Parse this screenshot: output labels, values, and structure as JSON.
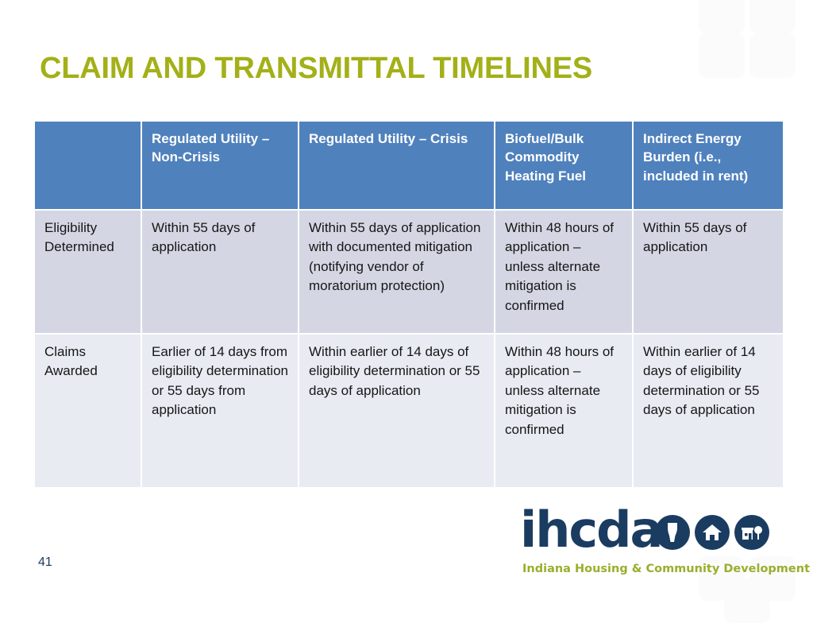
{
  "slide": {
    "title": "CLAIM AND TRANSMITTAL TIMELINES",
    "page_number": "41",
    "title_color": "#A3B018",
    "header_color": "#4F81BD",
    "row1_color": "#D4D7E3",
    "row2_color": "#E8EBF2"
  },
  "table": {
    "headers": [
      "",
      "Regulated Utility – Non-Crisis",
      "Regulated Utility – Crisis",
      "Biofuel/Bulk Commodity Heating Fuel",
      "Indirect Energy Burden (i.e., included in rent)"
    ],
    "rows": [
      {
        "label": "Eligibility Determined",
        "cells": [
          "Within 55 days of application",
          "Within 55 days of application with documented mitigation (notifying vendor of moratorium protection)",
          "Within 48 hours of application – unless alternate mitigation is confirmed",
          "Within 55 days of application"
        ]
      },
      {
        "label": "Claims Awarded",
        "cells": [
          "Earlier of 14 days from eligibility determination or 55 days from application",
          "Within earlier of 14 days of eligibility determination or 55 days of application",
          "Within 48 hours of application – unless alternate mitigation is confirmed",
          "Within earlier of 14 days of eligibility determination or 55 days of application"
        ]
      }
    ]
  },
  "logo": {
    "wordmark": "ihcda",
    "tagline": "Indiana Housing & Community Development Authority",
    "icons": [
      "indiana-state-icon",
      "house-icon",
      "building-tree-icon"
    ],
    "navy": "#1B3C61",
    "olive": "#9AAE2C"
  }
}
